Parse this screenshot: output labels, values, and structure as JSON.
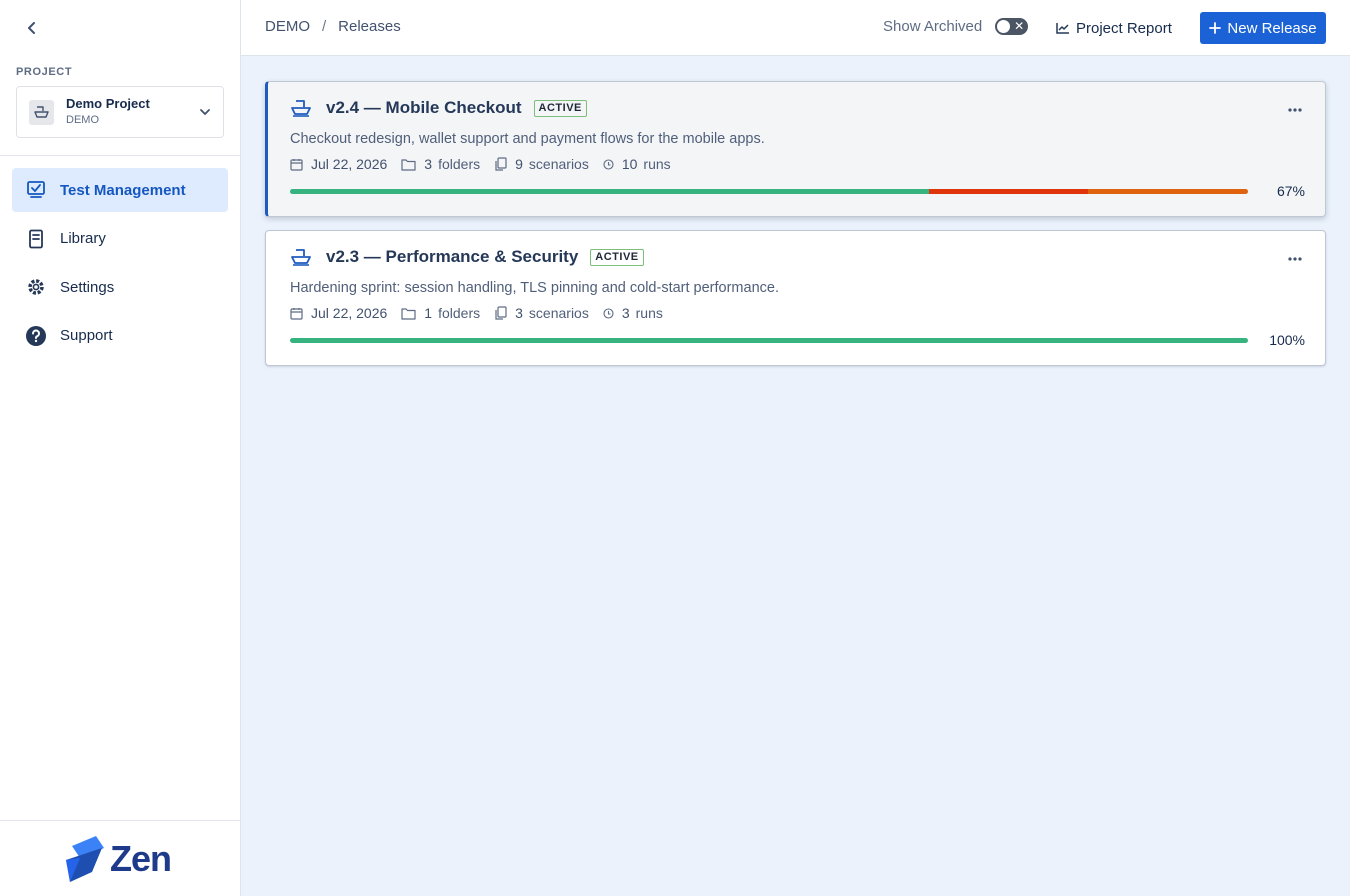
{
  "sidebar": {
    "project_label": "PROJECT",
    "project": {
      "name": "Demo Project",
      "key": "DEMO"
    },
    "nav": [
      {
        "label": "Test Management",
        "icon": "test-management-icon",
        "active": true
      },
      {
        "label": "Library",
        "icon": "library-icon",
        "active": false
      },
      {
        "label": "Settings",
        "icon": "gear-icon",
        "active": false
      },
      {
        "label": "Support",
        "icon": "help-icon",
        "active": false
      }
    ],
    "logo_text": "Zen"
  },
  "header": {
    "breadcrumb": {
      "root": "DEMO",
      "separator": "/",
      "current": "Releases"
    },
    "show_archived_label": "Show Archived",
    "show_archived_on": false,
    "project_report_label": "Project Report",
    "new_release_label": "New Release"
  },
  "colors": {
    "accent": "#1a62d6",
    "passed": "#36b37e",
    "failed": "#de350b",
    "blocked": "#e0640f"
  },
  "releases": [
    {
      "title": "v2.4 — Mobile Checkout",
      "status": "ACTIVE",
      "description": "Checkout redesign, wallet support and payment flows for the mobile apps.",
      "date": "Jul 22, 2026",
      "folders": "3",
      "folders_label": "folders",
      "scenarios": "9",
      "scenarios_label": "scenarios",
      "runs": "10",
      "runs_label": "runs",
      "progress": [
        {
          "status": "passed",
          "fraction": 0.667
        },
        {
          "status": "failed",
          "fraction": 0.166
        },
        {
          "status": "blocked",
          "fraction": 0.167
        }
      ],
      "progress_pct": "67%",
      "selected": true
    },
    {
      "title": "v2.3 — Performance & Security",
      "status": "ACTIVE",
      "description": "Hardening sprint: session handling, TLS pinning and cold-start performance.",
      "date": "Jul 22, 2026",
      "folders": "1",
      "folders_label": "folders",
      "scenarios": "3",
      "scenarios_label": "scenarios",
      "runs": "3",
      "runs_label": "runs",
      "progress": [
        {
          "status": "passed",
          "fraction": 1.0
        }
      ],
      "progress_pct": "100%",
      "selected": false
    }
  ]
}
